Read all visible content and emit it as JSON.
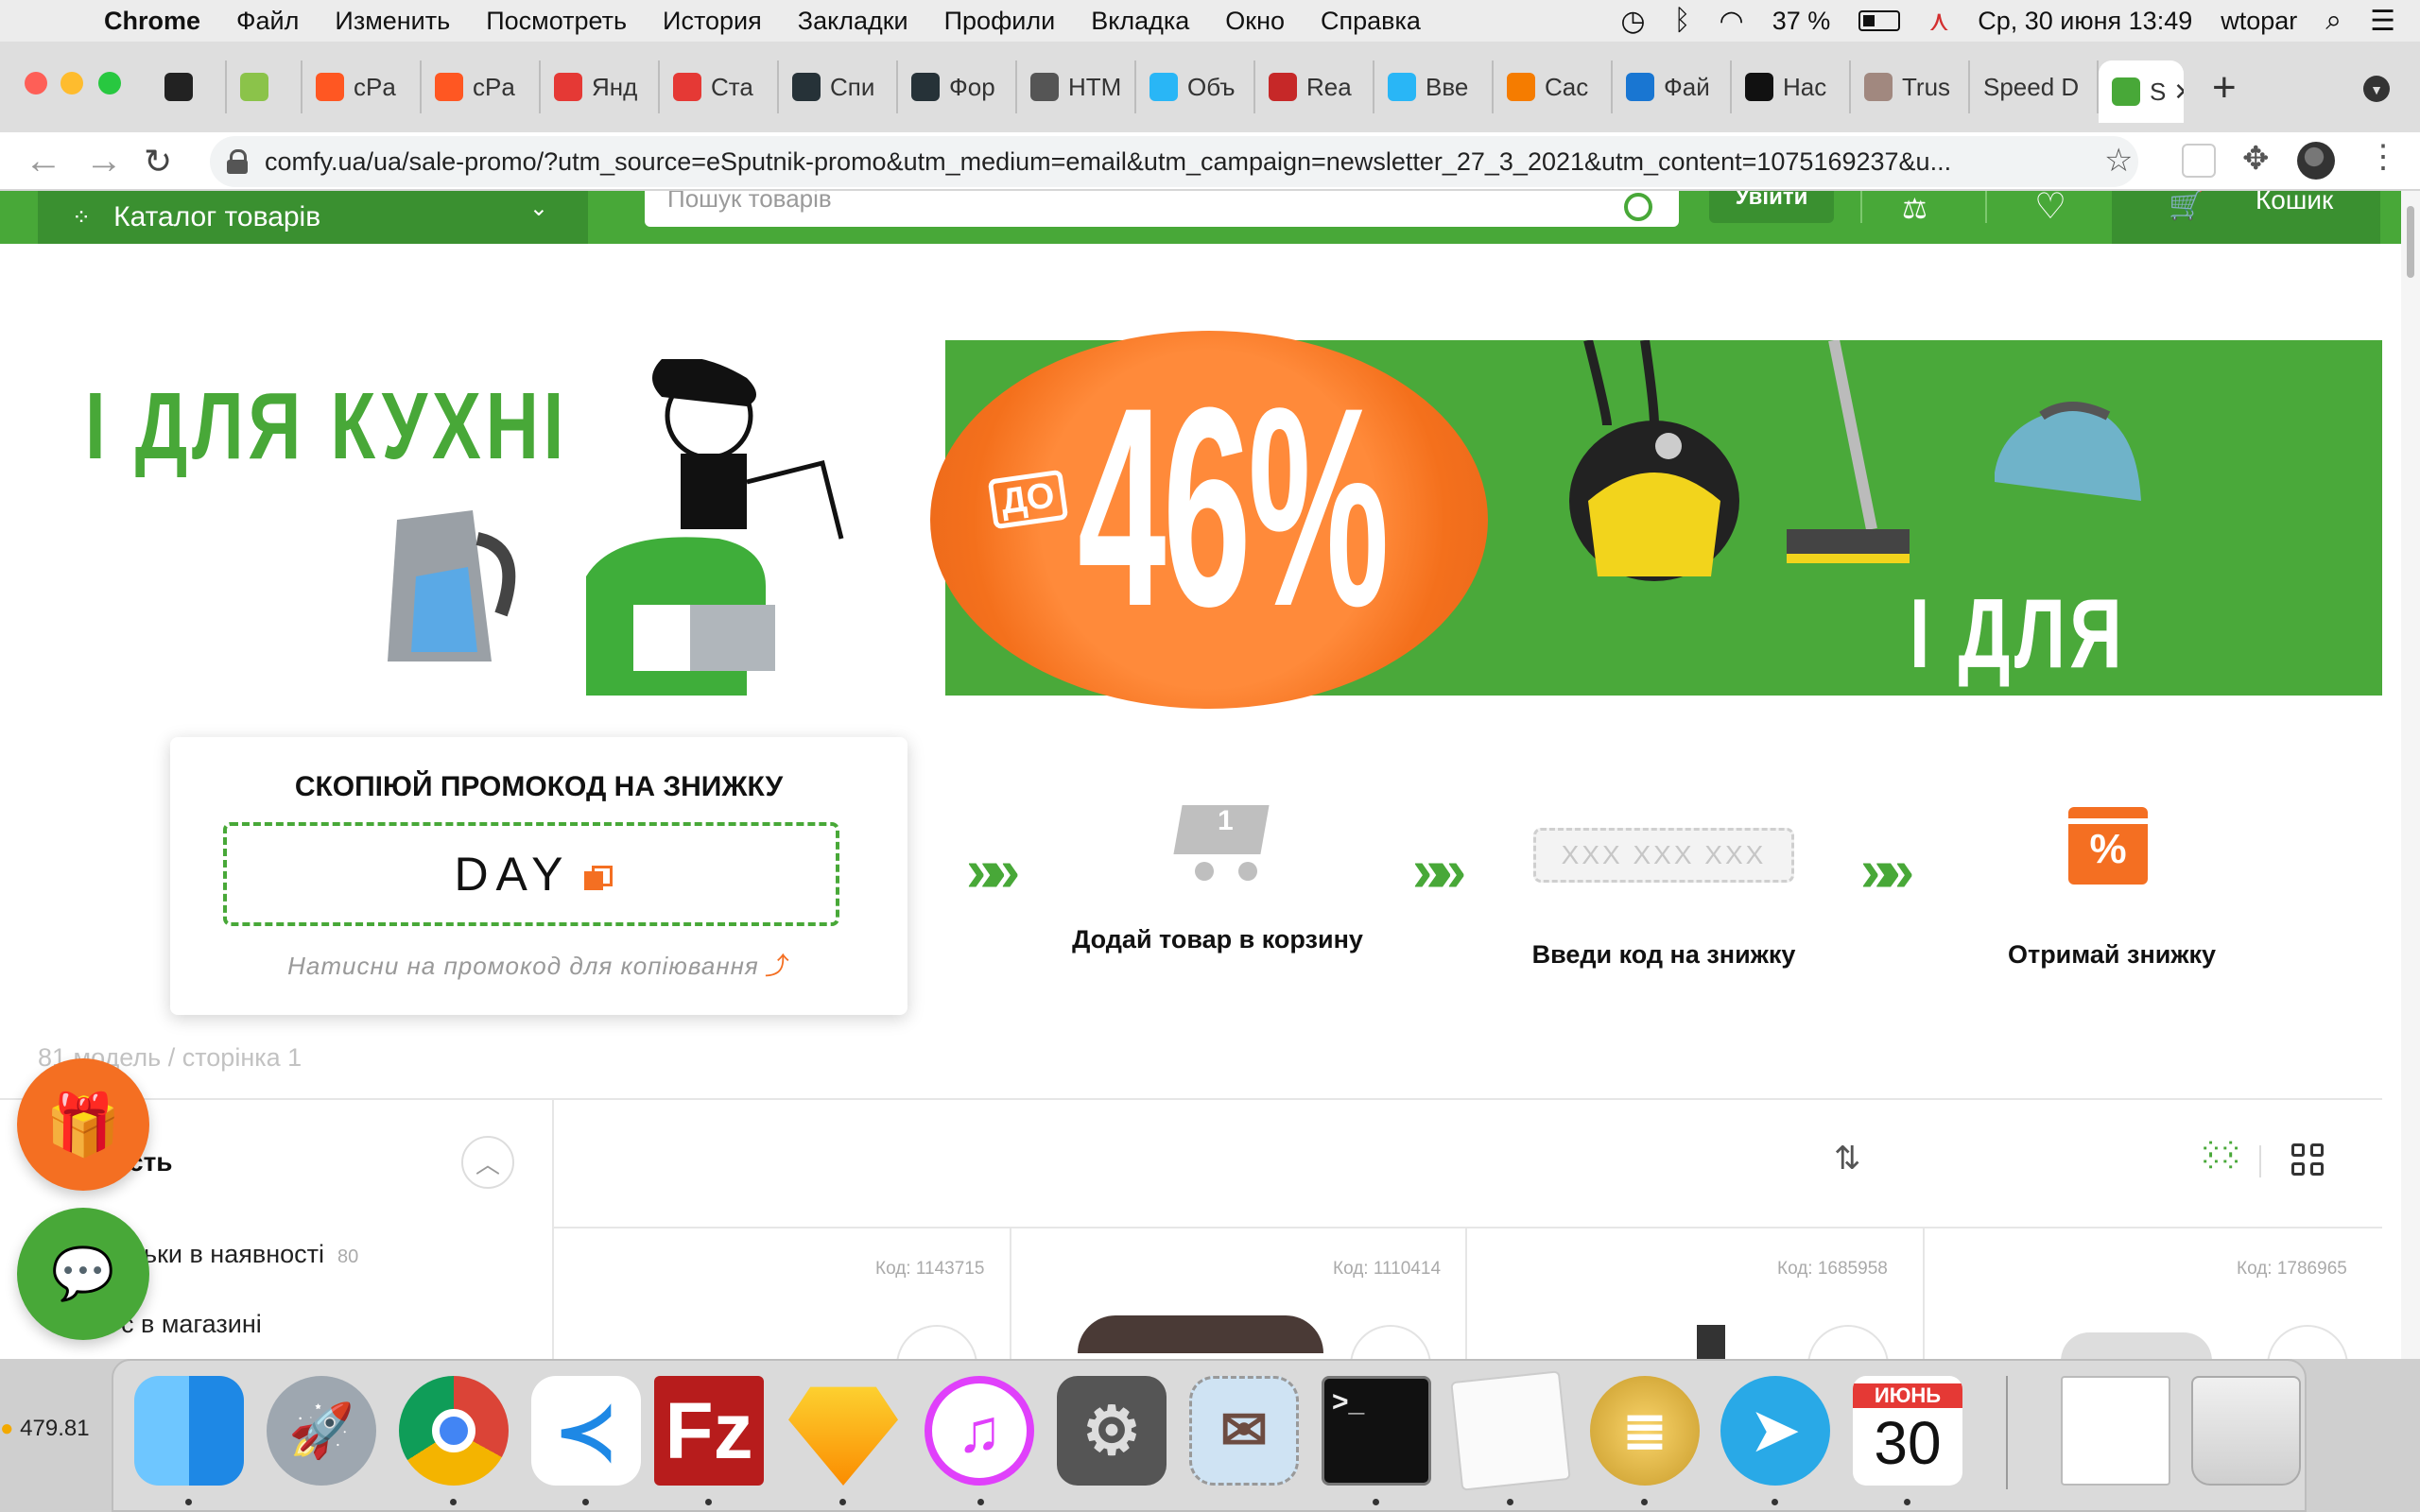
{
  "menubar": {
    "app_name": "Chrome",
    "items": [
      "Файл",
      "Изменить",
      "Посмотреть",
      "История",
      "Закладки",
      "Профили",
      "Вкладка",
      "Окно",
      "Справка"
    ],
    "battery": "37 %",
    "datetime": "Ср, 30 июня  13:49",
    "user": "wtopar"
  },
  "tabs": [
    {
      "label": "",
      "icon": "chrome-icon",
      "color": "#222"
    },
    {
      "label": "",
      "icon": "stripe-icon",
      "color": "#8bc34a"
    },
    {
      "label": "cPa",
      "icon": "cpa-icon",
      "color": "#ff5722"
    },
    {
      "label": "cPa",
      "icon": "cpa-icon",
      "color": "#ff5722"
    },
    {
      "label": "Янд",
      "icon": "yandex-icon",
      "color": "#e53935"
    },
    {
      "label": "Ста",
      "icon": "yandex-icon",
      "color": "#e53935"
    },
    {
      "label": "Спи",
      "icon": "react-icon",
      "color": "#263238"
    },
    {
      "label": "Фор",
      "icon": "react-icon",
      "color": "#263238"
    },
    {
      "label": "HTM",
      "icon": "globe-icon",
      "color": "#555"
    },
    {
      "label": "Объ",
      "icon": "star-burst-icon",
      "color": "#29b6f6"
    },
    {
      "label": "Rea",
      "icon": "dots-icon",
      "color": "#c62828"
    },
    {
      "label": "Вве",
      "icon": "star-burst-icon",
      "color": "#29b6f6"
    },
    {
      "label": "Cac",
      "icon": "cloudflare-icon",
      "color": "#f57c00"
    },
    {
      "label": "Фай",
      "icon": "drive-icon",
      "color": "#1976d2"
    },
    {
      "label": "Нас",
      "icon": "p-icon",
      "color": "#111"
    },
    {
      "label": "Trus",
      "icon": "dog-icon",
      "color": "#a1887f"
    },
    {
      "label": "Speed D",
      "icon": "",
      "color": ""
    },
    {
      "label": "S",
      "icon": "comfy-icon",
      "color": "#48a838",
      "active": true
    }
  ],
  "address": {
    "url": "comfy.ua/ua/sale-promo/?utm_source=eSputnik-promo&utm_medium=email&utm_campaign=newsletter_27_3_2021&utm_content=1075169237&u..."
  },
  "header": {
    "catalog_label": "Каталог товарів",
    "search_placeholder": "Пошук товарів",
    "login_label": "Увійти",
    "cart_label": "Кошик"
  },
  "banner": {
    "left_text": "І ДЛЯ КУХНІ",
    "discount_prefix": "ДО",
    "discount_value": "46%",
    "right_text": "І ДЛЯ ДОМУ"
  },
  "promo": {
    "title": "СКОПІЮЙ ПРОМОКОД НА ЗНИЖКУ",
    "code": "DAY",
    "hint": "Натисни на промокод для копіювання",
    "steps": [
      {
        "label": "Додай товар в корзину",
        "icon": "cart-icon",
        "badge": "1"
      },
      {
        "label": "Введи код на знижку",
        "placeholder": "XXX XXX XXX"
      },
      {
        "label": "Отримай знижку",
        "icon": "gift-percent-icon",
        "badge": "%"
      }
    ]
  },
  "listing": {
    "models_count": "81 модель / сторінка 1",
    "filter_heading": "сть",
    "filter_options": [
      {
        "label": "ьки в наявності",
        "count": "80"
      },
      {
        "label": "с в магазині",
        "count": ""
      }
    ],
    "product_codes": [
      "Код: 1143715",
      "Код: 1110414",
      "Код: 1685958",
      "Код: 1786965"
    ]
  },
  "desktop": {
    "stock_value": "479.81"
  },
  "dock": {
    "apps": [
      "Finder",
      "Launchpad",
      "Google Chrome",
      "Visual Studio Code",
      "FileZilla",
      "Sketch",
      "iTunes",
      "System Preferences",
      "Mail",
      "Terminal",
      "TextEdit",
      "Sequel Pro",
      "Telegram",
      "Calendar",
      "Preview",
      "Trash"
    ],
    "calendar_month": "ИЮНЬ",
    "calendar_day": "30"
  }
}
